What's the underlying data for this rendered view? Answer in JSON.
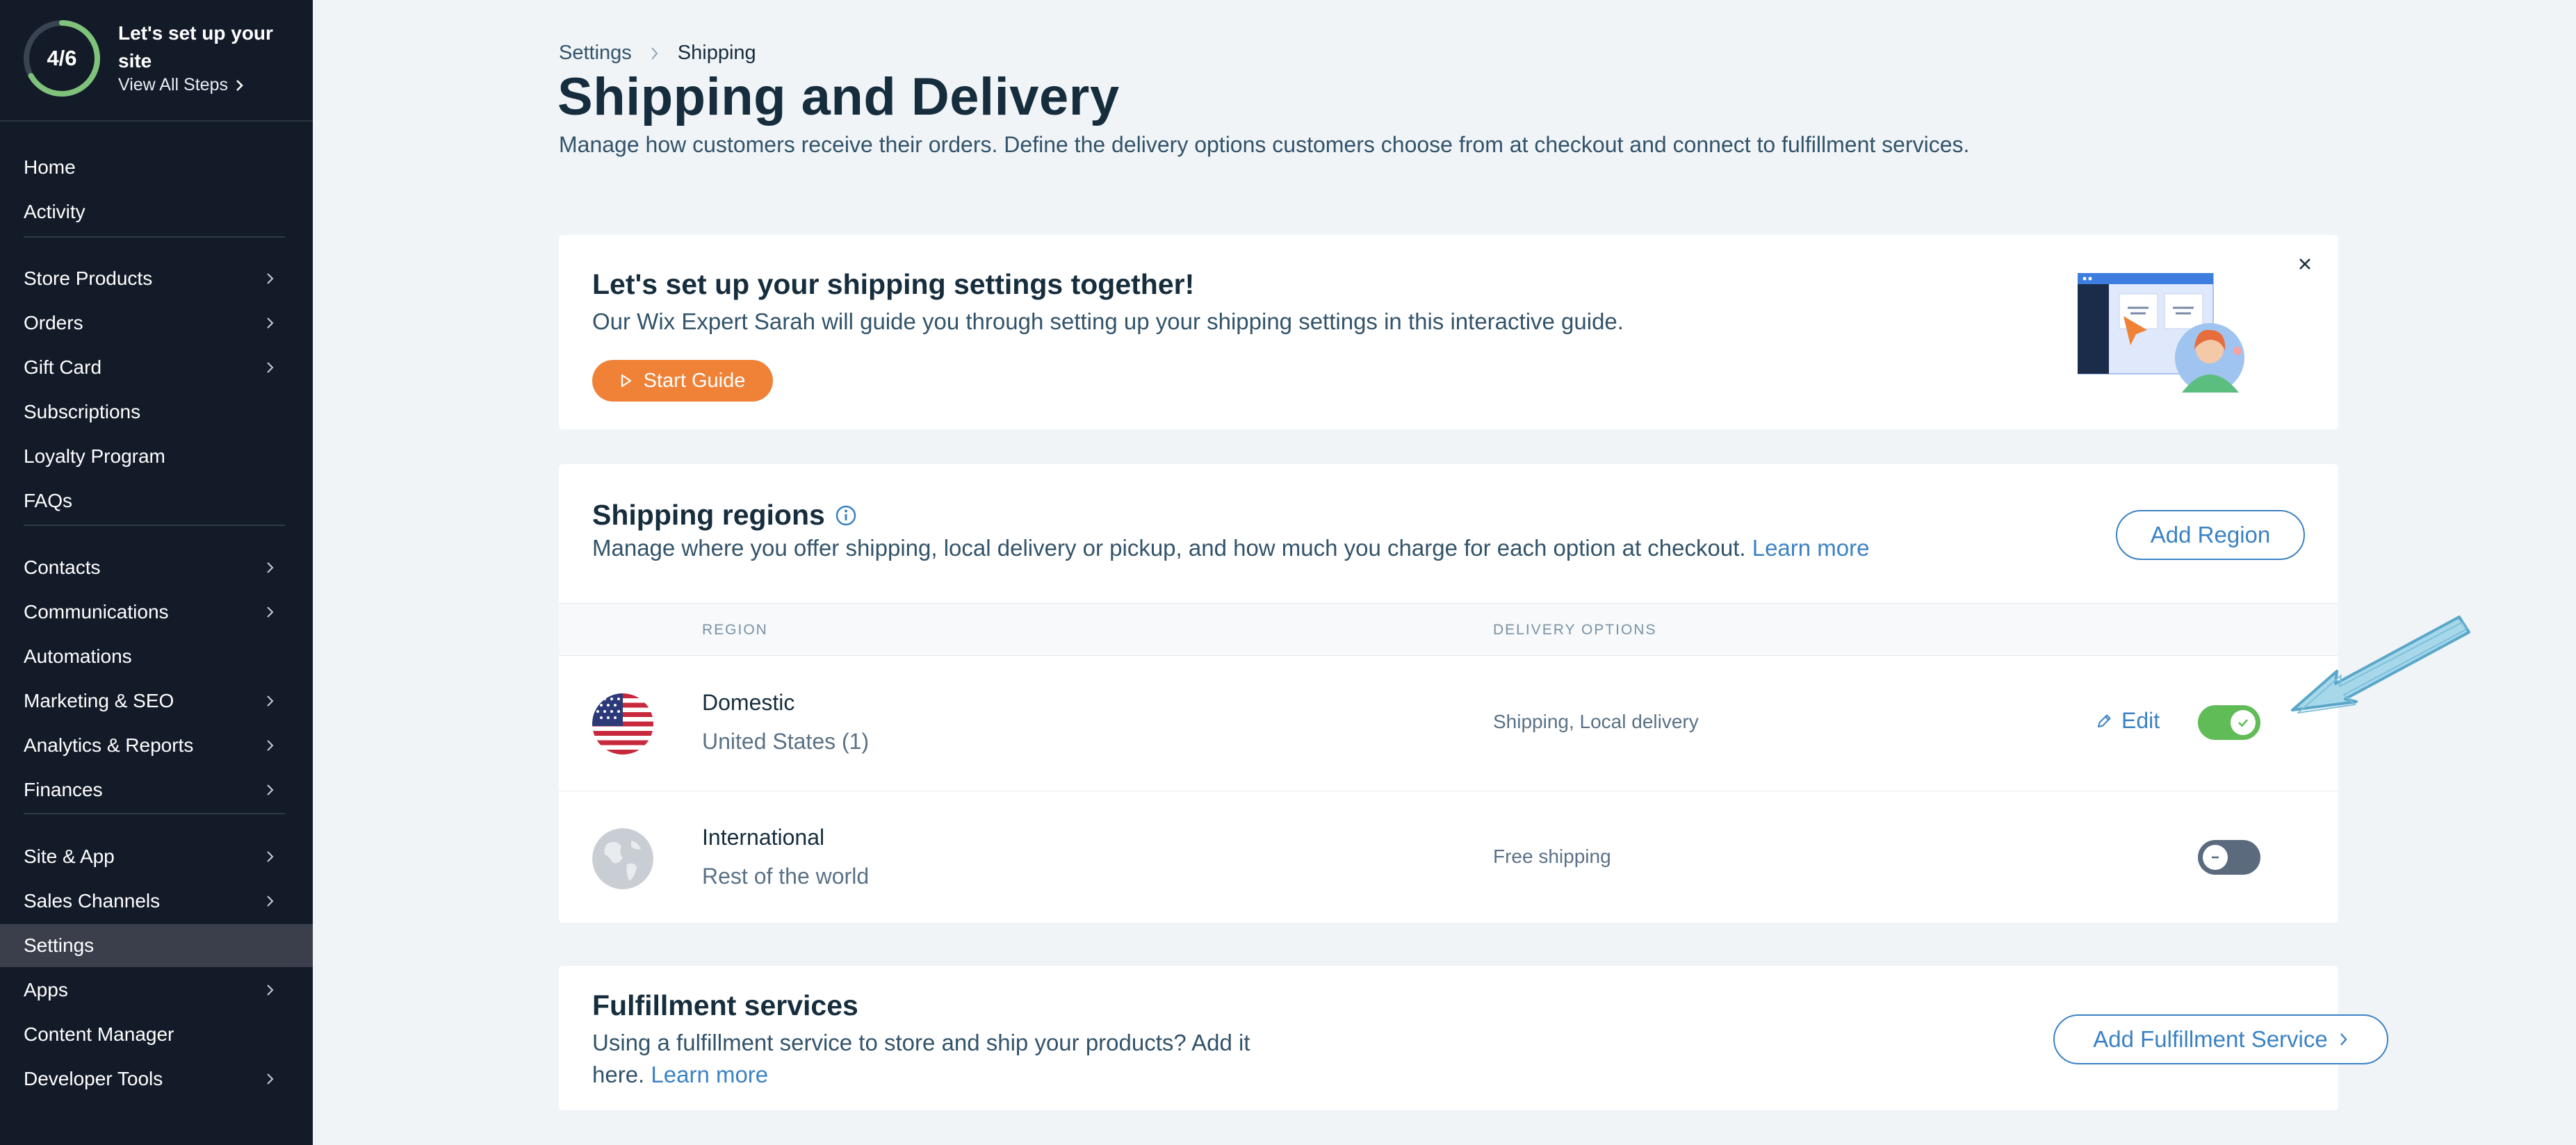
{
  "sidebar": {
    "setup": {
      "progress_text": "4/6",
      "progress_fraction": 0.667,
      "title": "Let's set up your site",
      "view_all": "View All Steps"
    },
    "items": [
      {
        "label": "Home",
        "chevron": false
      },
      {
        "label": "Activity",
        "chevron": false
      },
      {
        "label": "Store Products",
        "chevron": true
      },
      {
        "label": "Orders",
        "chevron": true
      },
      {
        "label": "Gift Card",
        "chevron": true
      },
      {
        "label": "Subscriptions",
        "chevron": false
      },
      {
        "label": "Loyalty Program",
        "chevron": false
      },
      {
        "label": "FAQs",
        "chevron": false
      },
      {
        "label": "Contacts",
        "chevron": true
      },
      {
        "label": "Communications",
        "chevron": true
      },
      {
        "label": "Automations",
        "chevron": false
      },
      {
        "label": "Marketing & SEO",
        "chevron": true
      },
      {
        "label": "Analytics & Reports",
        "chevron": true
      },
      {
        "label": "Finances",
        "chevron": true
      },
      {
        "label": "Site & App",
        "chevron": true
      },
      {
        "label": "Sales Channels",
        "chevron": true
      },
      {
        "label": "Settings",
        "chevron": false,
        "active": true
      },
      {
        "label": "Apps",
        "chevron": true
      },
      {
        "label": "Content Manager",
        "chevron": false
      },
      {
        "label": "Developer Tools",
        "chevron": true
      }
    ]
  },
  "breadcrumb": {
    "parent": "Settings",
    "current": "Shipping"
  },
  "page": {
    "title": "Shipping and Delivery",
    "subtitle": "Manage how customers receive their orders. Define the delivery options customers choose from at checkout and connect to fulfillment services."
  },
  "guide": {
    "title": "Let's set up your shipping settings together!",
    "description": "Our Wix Expert Sarah will guide you through setting up your shipping settings in this interactive guide.",
    "button": "Start Guide"
  },
  "regions": {
    "title": "Shipping regions",
    "description": "Manage where you offer shipping, local delivery or pickup, and how much you charge for each option at checkout.",
    "learn_more": "Learn more",
    "add_button": "Add Region",
    "columns": {
      "region": "REGION",
      "delivery": "DELIVERY OPTIONS"
    },
    "rows": [
      {
        "name": "Domestic",
        "sub": "United States (1)",
        "delivery": "Shipping, Local delivery",
        "edit": "Edit",
        "enabled": true
      },
      {
        "name": "International",
        "sub": "Rest of the world",
        "delivery": "Free shipping",
        "edit": "",
        "enabled": false
      }
    ]
  },
  "fulfillment": {
    "title": "Fulfillment services",
    "description": "Using a fulfillment service to store and ship your products? Add it here.",
    "learn_more": "Learn more",
    "add_button": "Add Fulfillment Service"
  },
  "colors": {
    "sidebar_bg": "#131b29",
    "accent_blue": "#3b82c4",
    "start_orange": "#ef8237",
    "toggle_on": "#60bc57",
    "toggle_off": "#5c6a7e"
  }
}
